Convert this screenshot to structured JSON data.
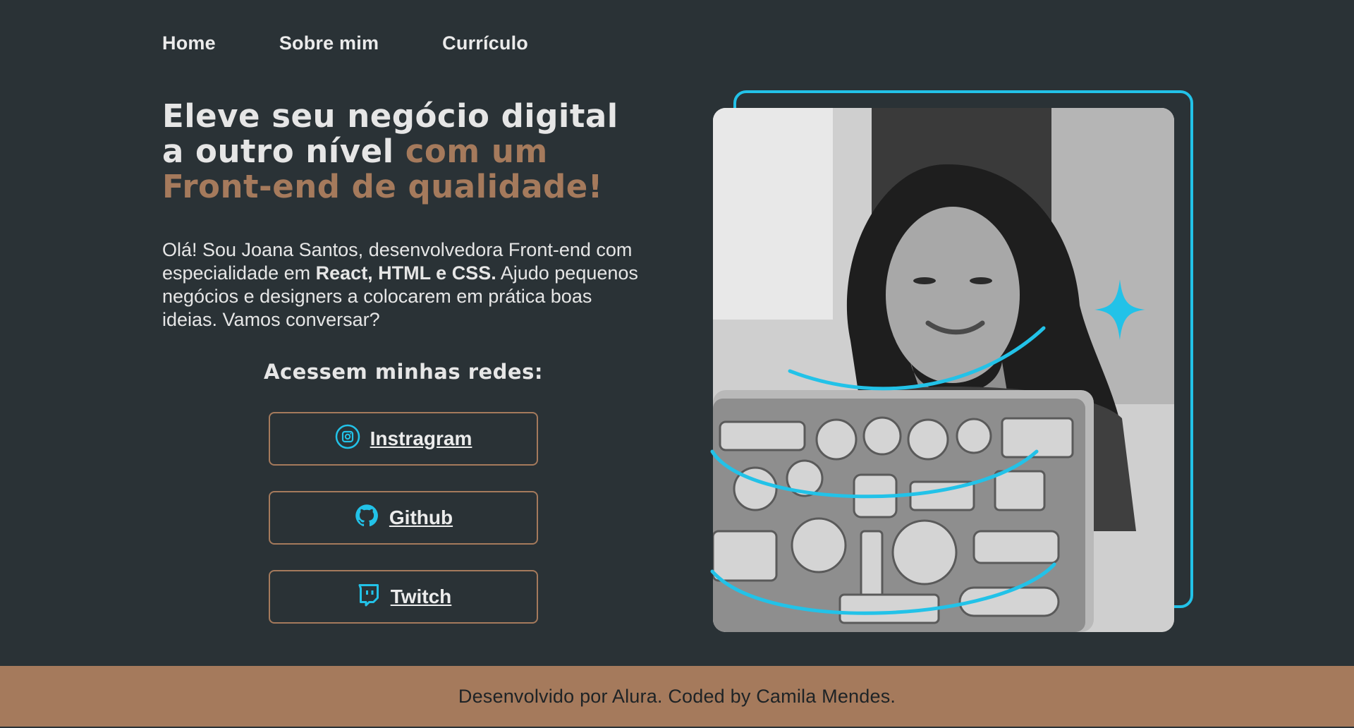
{
  "nav": {
    "home": "Home",
    "about": "Sobre mim",
    "cv": "Currículo"
  },
  "hero": {
    "headline_part1": "Eleve seu negócio digital a outro nível ",
    "headline_accent": "com um Front-end de qualidade!",
    "intro_part1": "Olá! Sou Joana Santos, desenvolvedora Front-end com especialidade em ",
    "intro_bold": "React, HTML e CSS.",
    "intro_part2": " Ajudo pequenos negócios e designers a colocarem em prática boas ideias. Vamos conversar?"
  },
  "social": {
    "title": "Acessem minhas redes:",
    "items": [
      {
        "label": "Instragram",
        "icon": "instagram-icon"
      },
      {
        "label": "Github",
        "icon": "github-icon"
      },
      {
        "label": "Twitch",
        "icon": "twitch-icon"
      }
    ]
  },
  "footer": {
    "text": "Desenvolvido por Alura. Coded by Camila Mendes."
  },
  "colors": {
    "background": "#2a3236",
    "accent_brown": "#a57a5c",
    "accent_cyan": "#22c2e8",
    "text_light": "#e6e6e6"
  }
}
